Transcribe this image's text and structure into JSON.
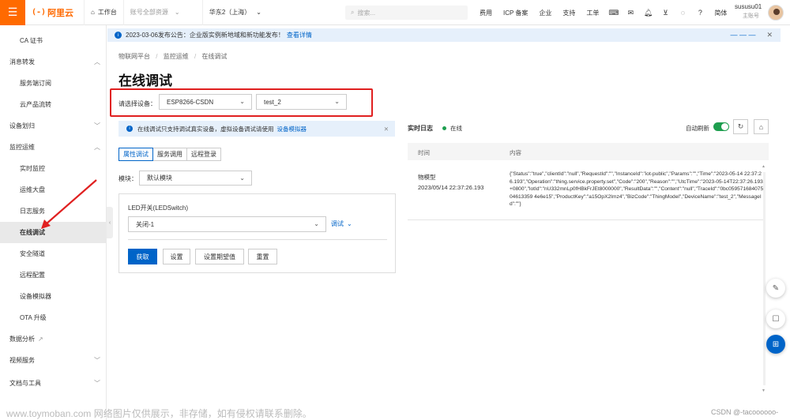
{
  "topbar": {
    "workbench": "工作台",
    "account_scope": "账号全部资源",
    "region": "华东2（上海）",
    "search_placeholder": "搜索...",
    "links": [
      "费用",
      "ICP 备案",
      "企业",
      "支持",
      "工单"
    ],
    "lang": "简体",
    "user_name": "sususu01",
    "user_role": "主账号",
    "logo_text": "阿里云",
    "logo_mark": "(-)"
  },
  "sidebar": {
    "items": [
      {
        "label": "CA 证书",
        "type": "sub"
      },
      {
        "label": "消息转发",
        "type": "group"
      },
      {
        "label": "服务端订阅",
        "type": "sub"
      },
      {
        "label": "云产品流转",
        "type": "sub"
      },
      {
        "label": "设备划归",
        "type": "group"
      },
      {
        "label": "监控运维",
        "type": "group"
      },
      {
        "label": "实时监控",
        "type": "sub"
      },
      {
        "label": "运维大盘",
        "type": "sub"
      },
      {
        "label": "日志服务",
        "type": "sub"
      },
      {
        "label": "在线调试",
        "type": "sub",
        "active": true
      },
      {
        "label": "安全隧道",
        "type": "sub"
      },
      {
        "label": "远程配置",
        "type": "sub"
      },
      {
        "label": "设备模拟器",
        "type": "sub"
      },
      {
        "label": "OTA 升级",
        "type": "sub"
      },
      {
        "label": "数据分析",
        "type": "group"
      },
      {
        "label": "视频服务",
        "type": "group"
      },
      {
        "label": "文档与工具",
        "type": "group"
      }
    ]
  },
  "notice": {
    "text": "2023-03-06发布公告：企业版实例新地域和新功能发布！",
    "link": "查看详情"
  },
  "breadcrumb": {
    "items": [
      "物联网平台",
      "监控运维",
      "在线调试"
    ]
  },
  "page": {
    "title": "在线调试",
    "device_label": "请选择设备：",
    "product_value": "ESP8266-CSDN",
    "device_value": "test_2",
    "info_text": "在线调试只支持调试真实设备，虚拟设备调试请使用",
    "info_link": "设备模拟器",
    "tabs": [
      "属性调试",
      "服务调用",
      "远程登录"
    ],
    "module_label": "模块：",
    "module_value": "默认模块",
    "property_label": "LED开关(LEDSwitch)",
    "property_value": "关闭-1",
    "debug_link": "调试",
    "buttons": {
      "get": "获取",
      "set": "设置",
      "set_expected": "设置期望值",
      "reset": "重置"
    }
  },
  "log": {
    "title": "实时日志",
    "status": "在线",
    "auto_refresh": "自动刷新",
    "col_time": "时间",
    "col_content": "内容",
    "row": {
      "type": "物模型",
      "time": "2023/05/14 22:37:26.193",
      "content": "{\"Status\":\"true\",\"clientId\":\"null\",\"RequestId\":\"\",\"InstanceId\":\"iot-public\",\"Params\":\"\",\"Time\":\"2023-05-14 22:37:26.193\",\"Operation\":\"thing.service.property.set\",\"Code\":\"200\",\"Reason\":\"\",\"UtcTime\":\"2023-05-14T22:37:26.193+0800\",\"lotId\":\"nU332mnLp0fHBkFrJEt8000000\",\"ResultData\":\"\",\"Content\":\"null\",\"TraceId\":\"0bc05957168407504613359 4e6e15\",\"ProductKey\":\"a15OpX2Imz4\",\"BizCode\":\"ThingModel\",\"DeviceName\":\"test_2\",\"MessageId\":\"\"}"
    }
  },
  "watermark": "www.toymoban.com 网络图片仅供展示，非存储，如有侵权请联系删除。",
  "csdn": "CSDN @-tacoooooo-",
  "colors": {
    "brand": "#ff6a00",
    "primary": "#0064c8",
    "highlight": "#e02020",
    "online": "#1e9e4f"
  }
}
